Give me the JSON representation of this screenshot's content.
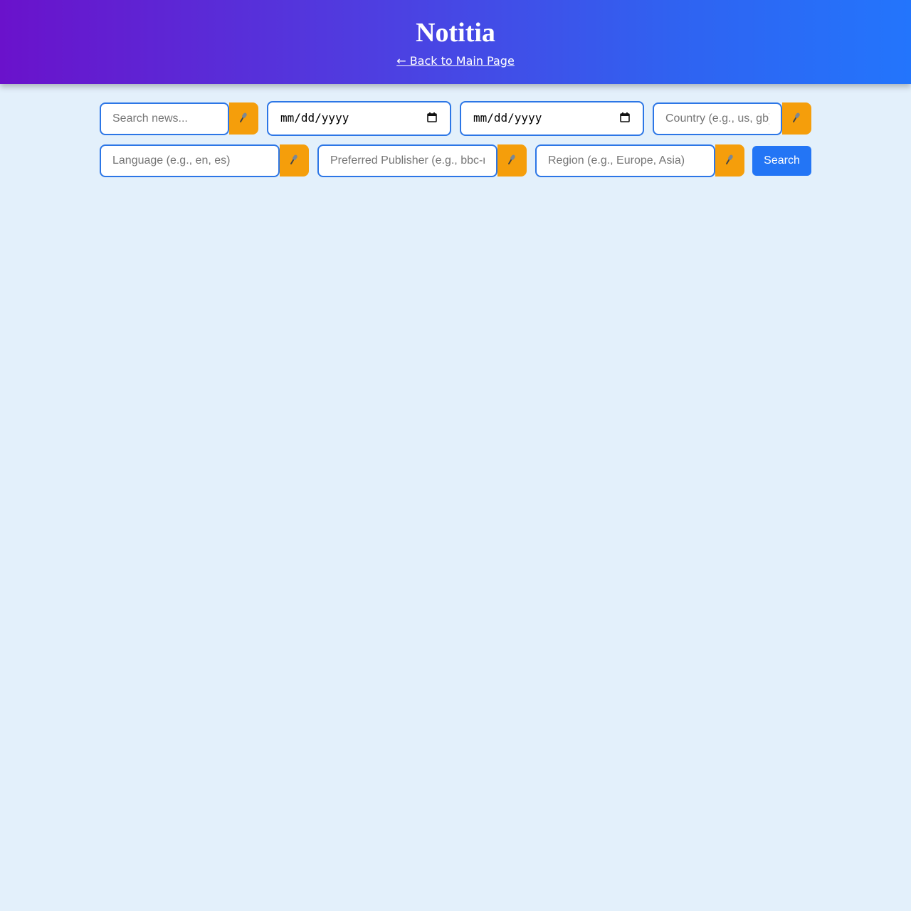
{
  "header": {
    "title": "Notitia",
    "back_link": "← Back to Main Page"
  },
  "search": {
    "query_placeholder": "Search news...",
    "from_date": "mm/dd/yyyy",
    "to_date": "mm/dd/yyyy",
    "country_placeholder": "Country (e.g., us, gb)",
    "language_placeholder": "Language (e.g., en, es)",
    "publisher_placeholder": "Preferred Publisher (e.g., bbc-news)",
    "region_placeholder": "Region (e.g., Europe, Asia)",
    "mic_icon": "microphone-icon",
    "calendar_icon": "calendar-icon",
    "search_button": "Search"
  },
  "colors": {
    "header_gradient_start": "#6a12cb",
    "header_gradient_end": "#2375fc",
    "accent_blue": "#2375f5",
    "mic_orange": "#f59e0b",
    "background": "#e3f0fb"
  }
}
